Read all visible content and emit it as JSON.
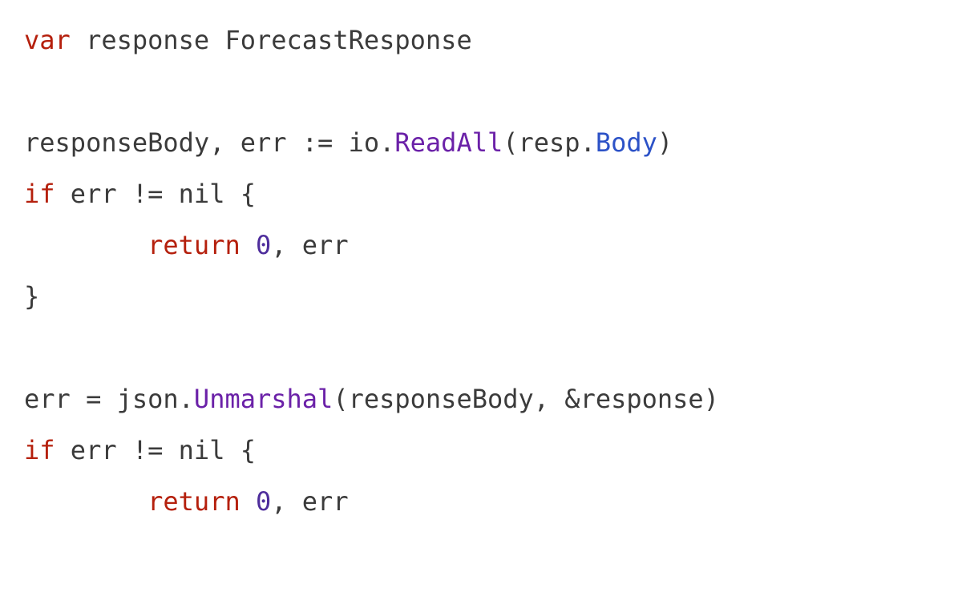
{
  "code": {
    "l1": {
      "var": "var",
      "decl": " response ForecastResponse"
    },
    "l3": {
      "lead": "responseBody, err := io.",
      "readall": "ReadAll",
      "mid": "(resp.",
      "body": "Body",
      "tail": ")"
    },
    "l4": {
      "if": "if",
      "rest": " err != nil {"
    },
    "l5": {
      "indent": "        ",
      "ret": "return",
      "sp": " ",
      "zero": "0",
      "rest": ", err"
    },
    "l6": {
      "brace": "}"
    },
    "l8": {
      "lead": "err = json.",
      "unmarshal": "Unmarshal",
      "tail": "(responseBody, &response)"
    },
    "l9": {
      "if": "if",
      "rest": " err != nil {"
    },
    "l10": {
      "indent": "        ",
      "ret": "return",
      "sp": " ",
      "zero": "0",
      "rest": ", err"
    }
  }
}
